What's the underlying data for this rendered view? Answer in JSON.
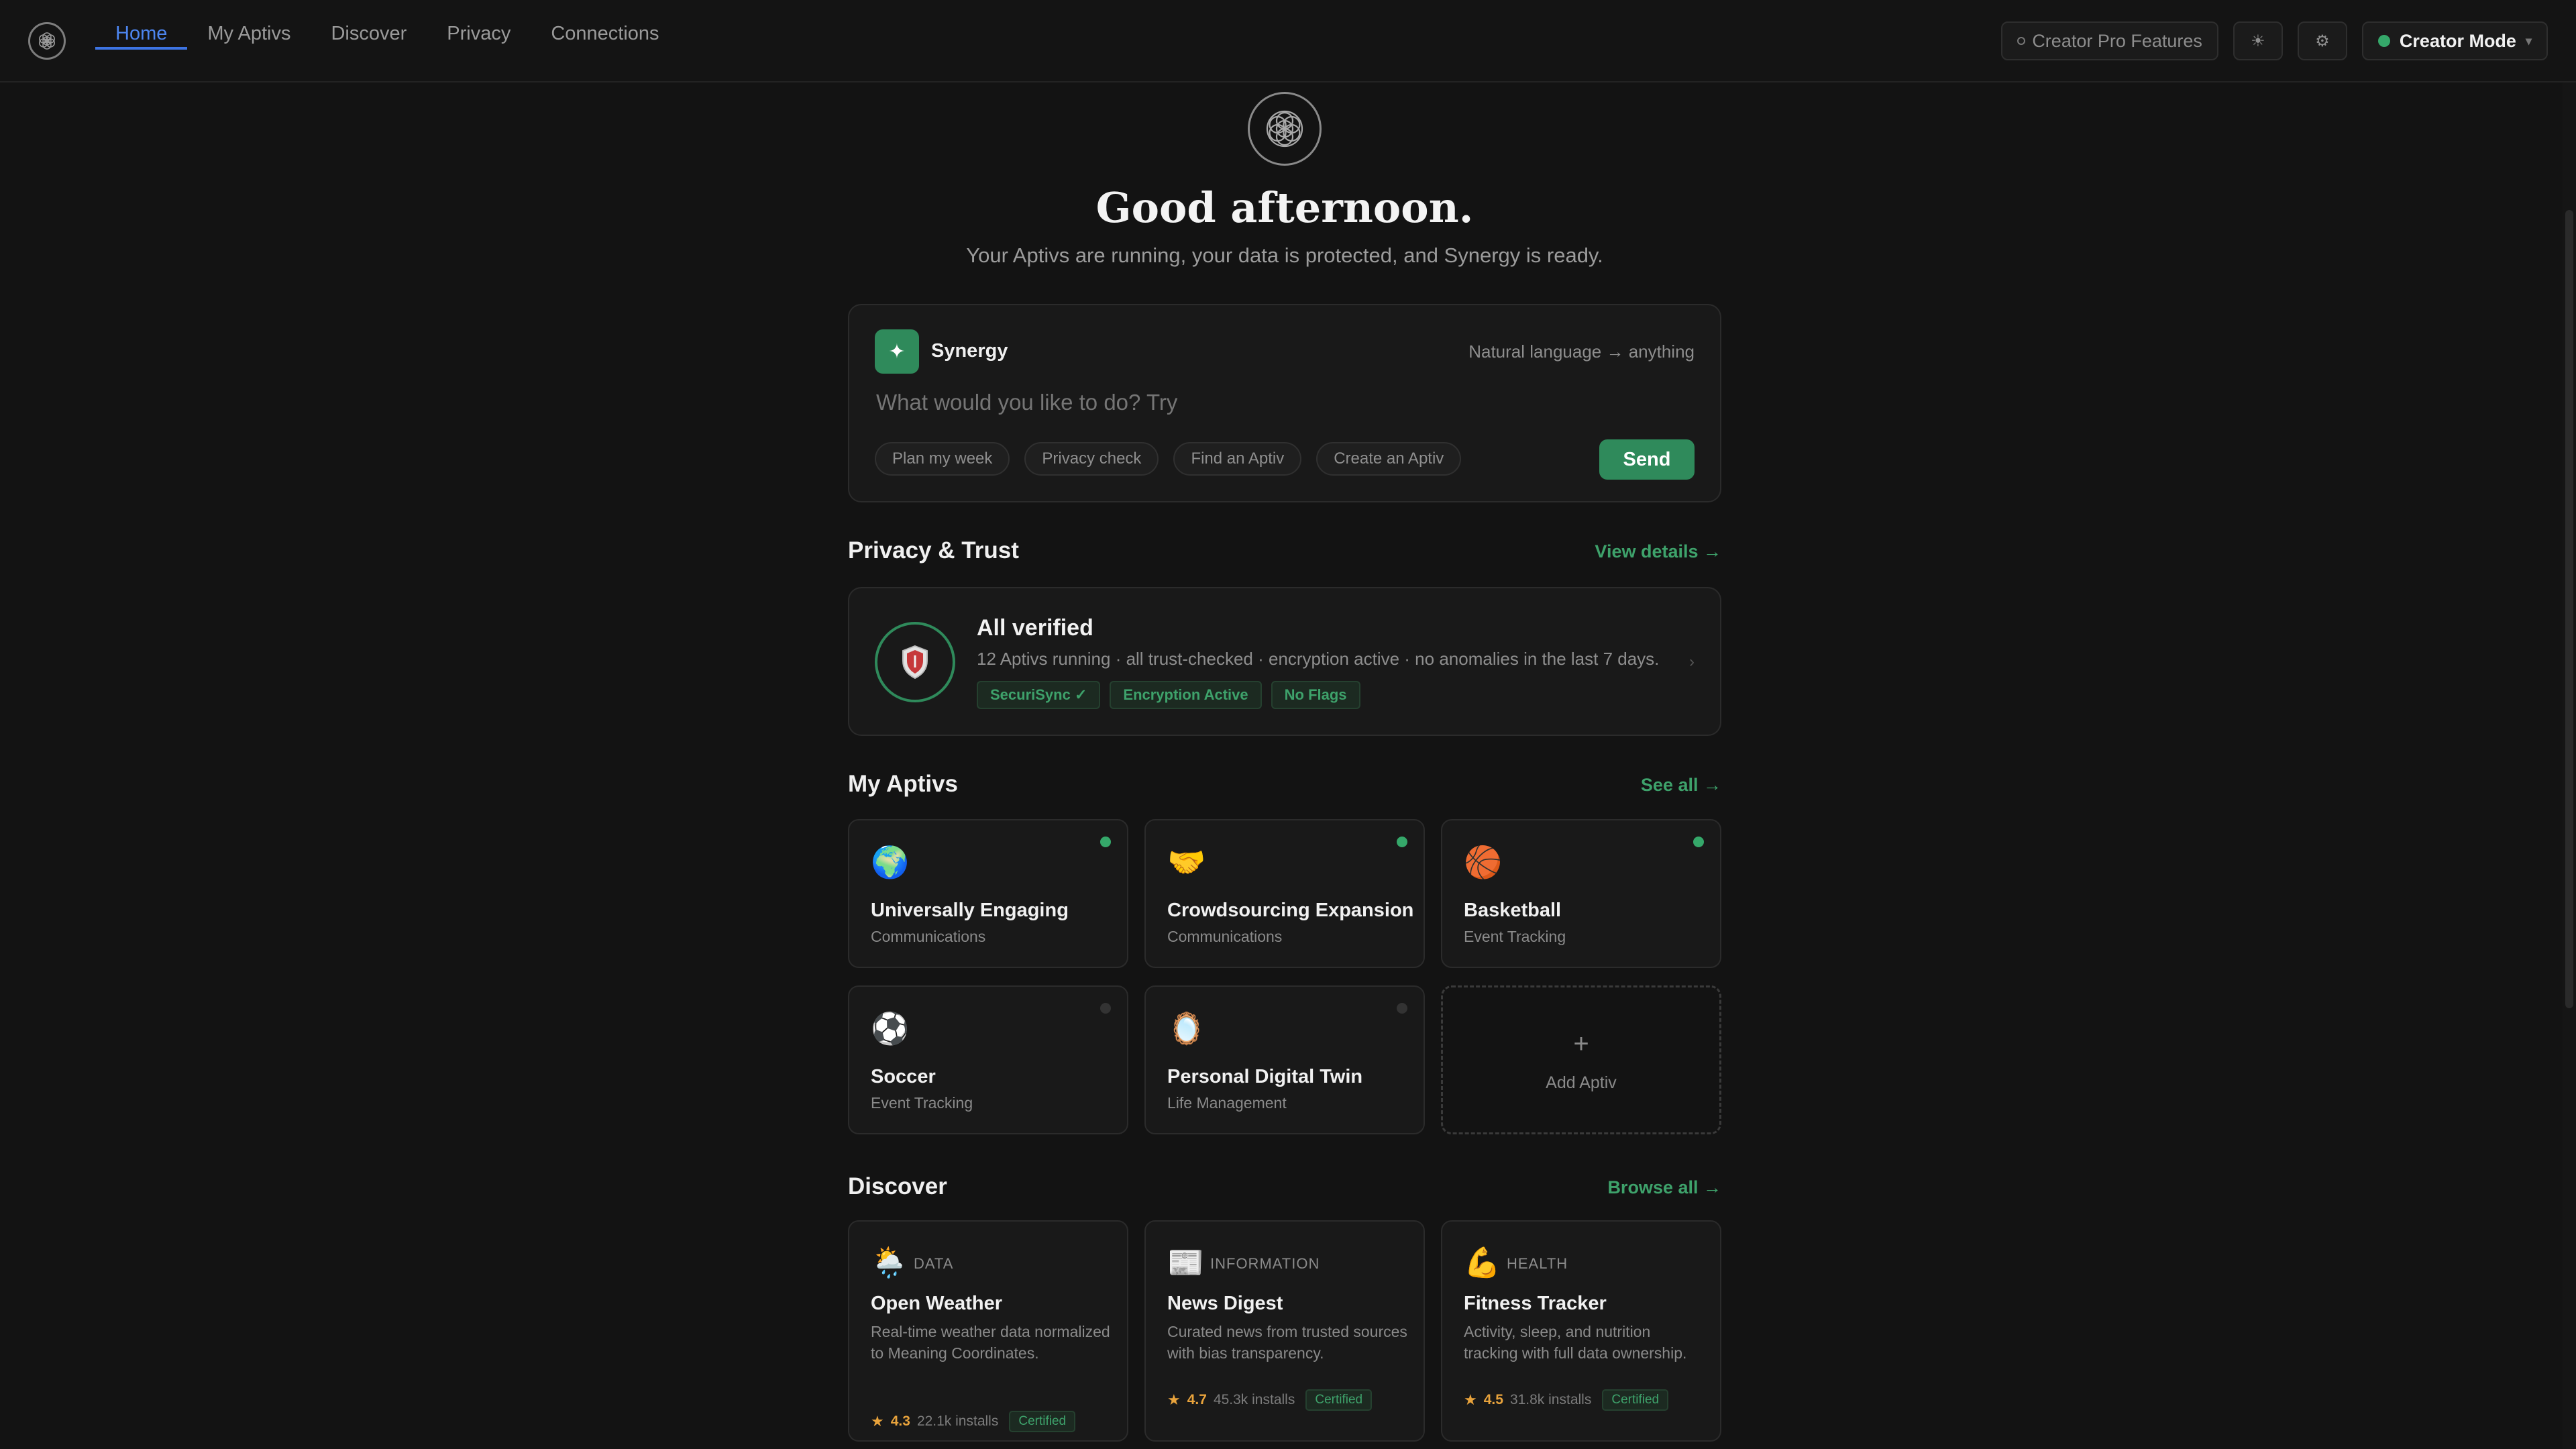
{
  "nav": {
    "items": [
      {
        "label": "Home",
        "active": true
      },
      {
        "label": "My Aptivs"
      },
      {
        "label": "Discover"
      },
      {
        "label": "Privacy"
      },
      {
        "label": "Connections"
      }
    ],
    "creator_pro_label": "Creator Pro Features",
    "creator_mode_label": "Creator Mode",
    "icons": [
      "sun-icon",
      "settings-icon"
    ]
  },
  "hero": {
    "greeting": "Good afternoon.",
    "subtitle": "Your Aptivs are running, your data is protected, and Synergy is ready."
  },
  "synergy": {
    "title": "Synergy",
    "hint": "Natural language → anything",
    "placeholder": "What would you like to do? Try",
    "chips": [
      "Plan my week",
      "Privacy check",
      "Find an Aptiv",
      "Create an Aptiv"
    ],
    "send_label": "Send"
  },
  "privacy": {
    "section_title": "Privacy & Trust",
    "link": "View details →",
    "title": "All verified",
    "description": "12 Aptivs running · all trust-checked · encryption active · no anomalies in the last 7 days.",
    "badges": [
      "SecuriSync ✓",
      "Encryption Active",
      "No Flags"
    ]
  },
  "my_aptivs": {
    "section_title": "My Aptivs",
    "link": "See all →",
    "items": [
      {
        "emoji": "🌍",
        "name": "Universally Engaging",
        "category": "Communications",
        "active": true
      },
      {
        "emoji": "🤝",
        "name": "Crowdsourcing Expansion",
        "category": "Communications",
        "active": true
      },
      {
        "emoji": "🏀",
        "name": "Basketball",
        "category": "Event Tracking",
        "active": true
      },
      {
        "emoji": "⚽",
        "name": "Soccer",
        "category": "Event Tracking",
        "active": false
      },
      {
        "emoji": "🪞",
        "name": "Personal Digital Twin",
        "category": "Life Management",
        "active": false
      }
    ],
    "add_label": "Add Aptiv",
    "add_symbol": "+"
  },
  "discover": {
    "section_title": "Discover",
    "link": "Browse all →",
    "items": [
      {
        "emoji": "🌦️",
        "category": "DATA",
        "name": "Open Weather",
        "description": "Real-time weather data normalized to Meaning Coordinates.",
        "rating": "4.3",
        "installs": "22.1k installs",
        "badge": "Certified"
      },
      {
        "emoji": "📰",
        "category": "INFORMATION",
        "name": "News Digest",
        "description": "Curated news from trusted sources with bias transparency.",
        "rating": "4.7",
        "installs": "45.3k installs",
        "badge": "Certified"
      },
      {
        "emoji": "💪",
        "category": "HEALTH",
        "name": "Fitness Tracker",
        "description": "Activity, sleep, and nutrition tracking with full data ownership.",
        "rating": "4.5",
        "installs": "31.8k installs",
        "badge": "Certified"
      }
    ]
  },
  "colors": {
    "accent_green": "#2f8a5b",
    "nav_active_blue": "#3d74e3",
    "background": "#131313"
  }
}
